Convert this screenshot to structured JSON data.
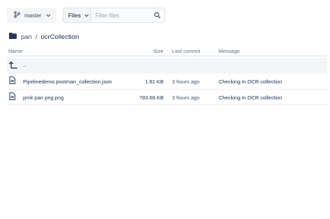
{
  "toolbar": {
    "branch": {
      "label": "master",
      "icon": "branch-icon"
    },
    "files": {
      "label": "Files",
      "icon": "chevron-down-icon"
    },
    "filter": {
      "placeholder": "Filter files",
      "value": "",
      "icon": "search-icon"
    }
  },
  "breadcrumb": {
    "icon": "folder-icon",
    "root": "pan",
    "separator": "/",
    "current": "ocrCollection"
  },
  "table": {
    "columns": [
      "Name",
      "Size",
      "Last commit",
      "Message"
    ],
    "parent_row": {
      "name": "..",
      "icon": "level-up-icon"
    },
    "rows": [
      {
        "name": "Pipelinedemo.postman_collection.json",
        "size": "1.81 KB",
        "last_commit": "3 hours ago",
        "message": "Checking in OCR collection",
        "icon": "file-icon"
      },
      {
        "name": "prnk pan png.png",
        "size": "783.69 KB",
        "last_commit": "3 hours ago",
        "message": "Checking in OCR collection",
        "icon": "file-icon"
      }
    ]
  },
  "colors": {
    "text": "#172b4d",
    "muted": "#5e6c84",
    "border": "#dfe1e6",
    "row_highlight": "#f4f5f7",
    "icon": "#253858"
  }
}
